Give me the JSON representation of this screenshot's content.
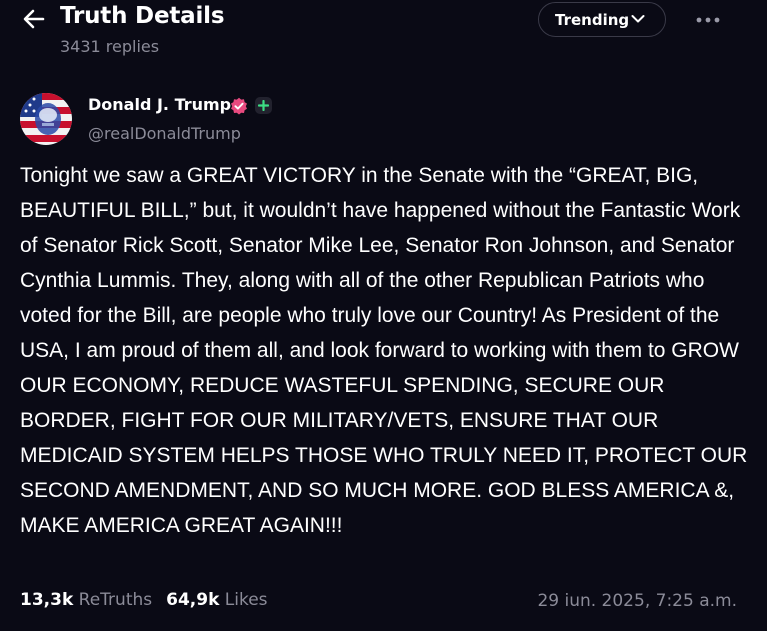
{
  "header": {
    "title": "Truth Details",
    "replies": "3431 replies",
    "sort_label": "Trending"
  },
  "post": {
    "author_name": "Donald J. Trump",
    "author_handle": "@realDonaldTrump",
    "body": "Tonight we saw a GREAT VICTORY in the Senate with the “GREAT, BIG, BEAUTIFUL BILL,” but, it wouldn’t have happened without the Fantastic Work of Senator Rick Scott, Senator Mike Lee, Senator Ron Johnson, and Senator Cynthia Lummis. They, along with all of the other Republican Patriots who voted for the Bill, are people who truly love our Country! As President of the USA, I am proud of them all, and look forward to working with them to GROW OUR ECONOMY, REDUCE WASTEFUL SPENDING, SECURE OUR BORDER, FIGHT FOR OUR MILITARY/VETS, ENSURE THAT OUR MEDICAID SYSTEM HELPS THOSE WHO TRULY NEED IT, PROTECT OUR SECOND AMENDMENT, AND SO MUCH MORE. GOD BLESS AMERICA &, MAKE AMERICA GREAT AGAIN!!!",
    "retruths_count": "13,3k",
    "retruths_label": "ReTruths",
    "likes_count": "64,9k",
    "likes_label": "Likes",
    "timestamp": "29 iun. 2025, 7:25 a.m."
  },
  "icons": {
    "back": "arrow-left-icon",
    "sort": "chevron-down-icon",
    "more": "more-horizontal-icon",
    "verified": "verified-badge-icon",
    "plus": "plus-badge-icon"
  },
  "colors": {
    "background": "#0a0a15",
    "text": "#ffffff",
    "muted": "#8b8b98",
    "verified": "#e84a7f",
    "plus_badge": "#3ddc84"
  }
}
